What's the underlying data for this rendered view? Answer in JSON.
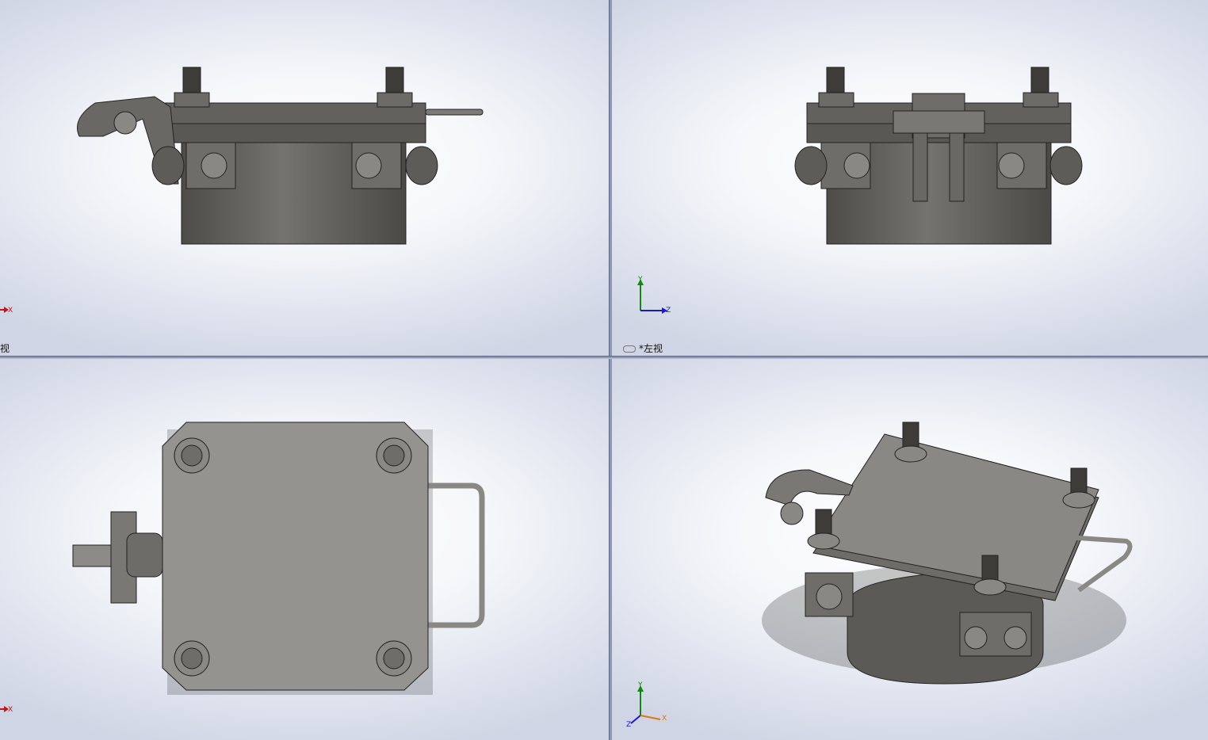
{
  "viewports": {
    "top_left": {
      "label": "视",
      "axis_labels": [
        "X"
      ]
    },
    "top_right": {
      "label": "*左视",
      "axis_labels": [
        "Y",
        "Z"
      ]
    },
    "bottom_left": {
      "axis_labels": [
        "X"
      ]
    },
    "bottom_right": {
      "axis_labels": [
        "Y",
        "X",
        "Z"
      ]
    }
  },
  "colors": {
    "metal": "#5f5d5a",
    "metal_light": "#9a9894",
    "axis_x": "#cc1111",
    "axis_y": "#118811",
    "axis_z": "#1a1acc"
  }
}
